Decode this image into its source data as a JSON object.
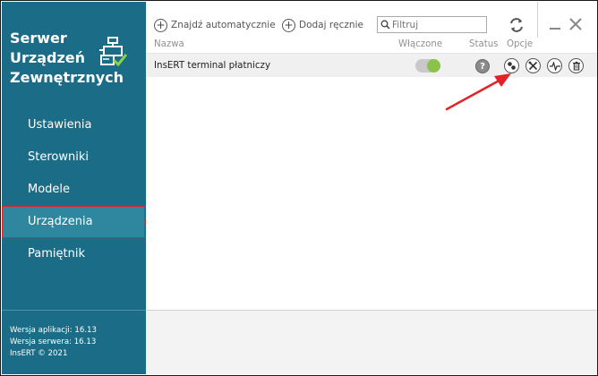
{
  "app": {
    "title": "Serwer\nUrządzeń\nZewnętrznych",
    "logo_icon": "device-check-icon"
  },
  "sidebar": {
    "items": [
      {
        "label": "Ustawienia",
        "active": false
      },
      {
        "label": "Sterowniki",
        "active": false
      },
      {
        "label": "Modele",
        "active": false
      },
      {
        "label": "Urządzenia",
        "active": true
      },
      {
        "label": "Pamiętnik",
        "active": false
      }
    ],
    "version": {
      "app": "Wersja aplikacji: 16.13",
      "server": "Wersja serwera: 16.13",
      "copyright": "InsERT © 2021"
    }
  },
  "toolbar": {
    "find_auto_label": "Znajdź automatycznie",
    "add_manual_label": "Dodaj ręcznie",
    "filter_placeholder": "Filtruj",
    "refresh_icon": "refresh-icon",
    "minimize_icon": "minimize-icon",
    "close_icon": "close-icon"
  },
  "table": {
    "columns": {
      "name": "Nazwa",
      "enabled": "Włączone",
      "status": "Status",
      "options": "Opcje"
    },
    "rows": [
      {
        "name": "InsERT terminal płatniczy",
        "enabled": true,
        "status": "?",
        "options": [
          "connect-icon",
          "settings-tools-icon",
          "test-signal-icon",
          "delete-icon"
        ]
      }
    ]
  },
  "colors": {
    "sidebar_bg": "#1b6c86",
    "sidebar_active": "#2f869f",
    "highlight_red": "#d9272c",
    "toggle_on": "#8bc34a"
  }
}
